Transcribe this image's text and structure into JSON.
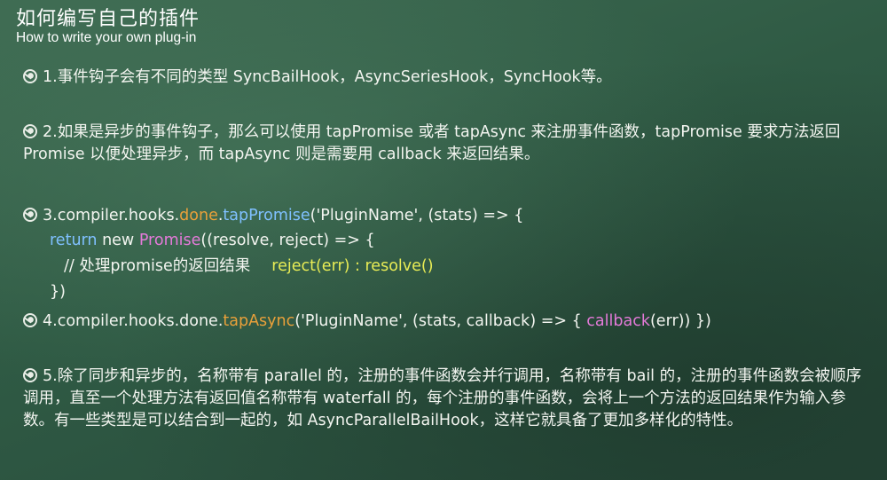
{
  "title": "如何编写自己的插件",
  "subtitle": "How to write your own plug-in",
  "item1": "1.事件钩子会有不同的类型 SyncBailHook，AsyncSeriesHook，SyncHook等。",
  "item2": "2.如果是异步的事件钩子，那么可以使用 tapPromise 或者 tapAsync 来注册事件函数，tapPromise 要求方法返回 Promise 以便处理异步，而 tapAsync 则是需要用 callback 来返回结果。",
  "code3": {
    "line1": {
      "prefix": "3.compiler.hooks.",
      "done": "done",
      "dot": ".",
      "method": "tapPromise",
      "suffix": "('PluginName', (stats) => {"
    },
    "line2": {
      "kw": "return",
      "new_kw": " new ",
      "cls": "Promise",
      "suffix": "((resolve, reject) => {"
    },
    "line3": {
      "comment": "// 处理promise的返回结果",
      "expr": "reject(err) : resolve()"
    },
    "line4": "})"
  },
  "code4": {
    "prefix": "4.compiler.hooks.done.",
    "method": "tapAsync",
    "middle": "('PluginName', (stats, callback) => { ",
    "call": "callback",
    "suffix": "(err)) })"
  },
  "item5": "5.除了同步和异步的，名称带有 parallel 的，注册的事件函数会并行调用，名称带有 bail 的，注册的事件函数会被顺序调用，直至一个处理方法有返回值名称带有 waterfall 的，每个注册的事件函数，会将上一个方法的返回结果作为输入参数。有一些类型是可以结合到一起的，如 AsyncParallelBailHook，这样它就具备了更加多样化的特性。",
  "colors": {
    "background": "#2f5a44",
    "orange": "#e9a03a",
    "blue": "#7fc0ff",
    "magenta": "#e47ad9",
    "yellow": "#e8ec55"
  },
  "icons": {
    "bullet": "chalk-swirl-bullet-icon"
  }
}
